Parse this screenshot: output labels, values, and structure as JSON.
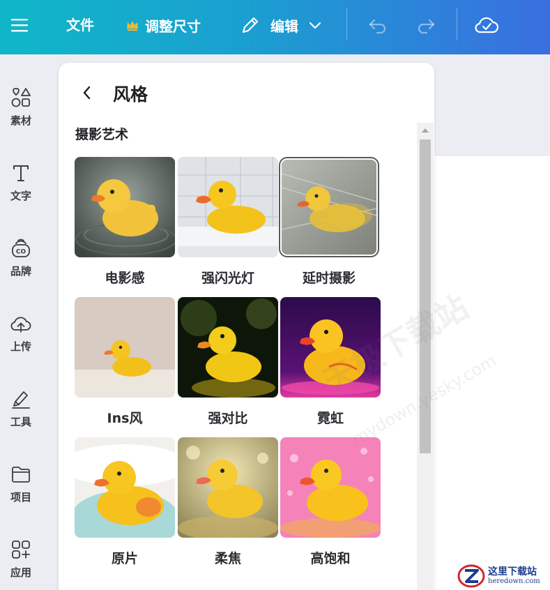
{
  "toolbar": {
    "menu_icon": "hamburger-icon",
    "file_label": "文件",
    "resize_label": "调整尺寸",
    "resize_icon": "crown-icon",
    "edit_label": "编辑",
    "edit_icon": "pencil-icon",
    "undo_icon": "undo-icon",
    "redo_icon": "redo-icon",
    "save_status_icon": "cloud-check-icon"
  },
  "sidebar": {
    "items": [
      {
        "label": "素材",
        "icon": "shapes-icon"
      },
      {
        "label": "文字",
        "icon": "text-icon"
      },
      {
        "label": "品牌",
        "icon": "brand-icon"
      },
      {
        "label": "上传",
        "icon": "upload-cloud-icon"
      },
      {
        "label": "工具",
        "icon": "pen-tool-icon"
      },
      {
        "label": "项目",
        "icon": "folder-icon"
      },
      {
        "label": "应用",
        "icon": "apps-icon"
      }
    ]
  },
  "panel": {
    "title": "风格",
    "section_title": "摄影艺术",
    "styles": [
      {
        "label": "电影感",
        "selected": false
      },
      {
        "label": "强闪光灯",
        "selected": false
      },
      {
        "label": "延时摄影",
        "selected": true
      },
      {
        "label": "Ins风",
        "selected": false
      },
      {
        "label": "强对比",
        "selected": false
      },
      {
        "label": "霓虹",
        "selected": false
      },
      {
        "label": "原片",
        "selected": false
      },
      {
        "label": "柔焦",
        "selected": false
      },
      {
        "label": "高饱和",
        "selected": false
      }
    ]
  },
  "watermark": {
    "text": "天极下载站",
    "url": "mydown.yesky.com"
  },
  "corner_logo": {
    "cn": "这里下载站",
    "en": "heredown.com"
  },
  "colors": {
    "accent_start": "#10b7c8",
    "accent_end": "#3a6ee0",
    "duck_yellow": "#f6c21a",
    "beak_orange": "#f0762a"
  }
}
